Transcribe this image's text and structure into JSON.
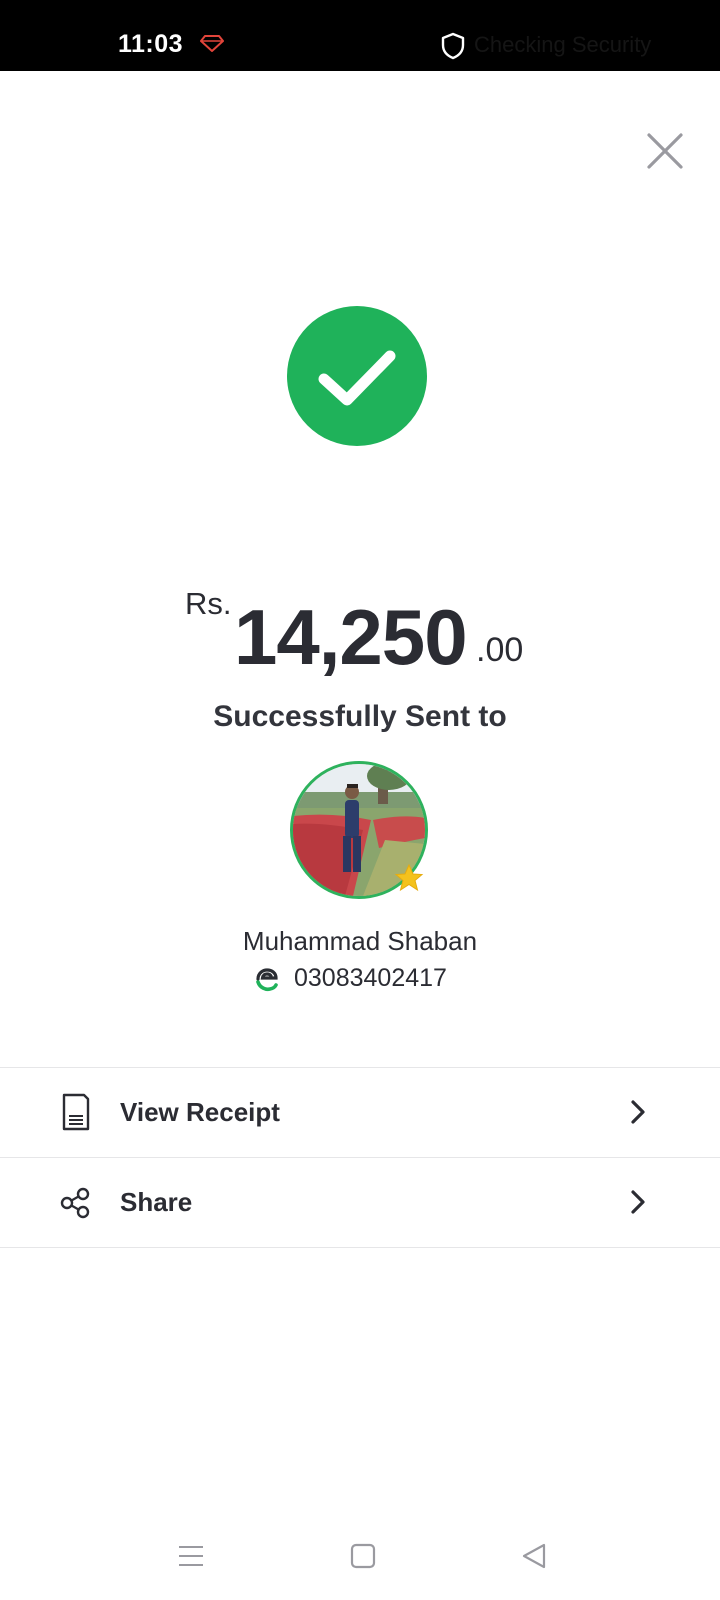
{
  "status_bar": {
    "time": "11:03",
    "security_text": "Checking Security",
    "icons": [
      "ruby-notification-icon",
      "shield-icon"
    ]
  },
  "header": {
    "close_icon": "close-icon"
  },
  "success": {
    "icon": "checkmark-icon",
    "color": "#1fb25a"
  },
  "transaction": {
    "currency": "Rs.",
    "amount_integer": "14,250",
    "amount_decimal": ".00",
    "status_text": "Successfully Sent to"
  },
  "recipient": {
    "avatar_icon": "recipient-avatar",
    "badge_icon": "star-icon",
    "name": "Muhammad Shaban",
    "phone_icon": "easypaisa-logo-icon",
    "phone": "03083402417",
    "accent_color": "#2eb25d"
  },
  "actions": [
    {
      "label": "View Receipt",
      "icon": "receipt-icon",
      "chevron": "chevron-right-icon"
    },
    {
      "label": "Share",
      "icon": "share-icon",
      "chevron": "chevron-right-icon"
    }
  ],
  "nav_bar": {
    "buttons": [
      "menu-icon",
      "home-icon",
      "back-icon"
    ]
  }
}
